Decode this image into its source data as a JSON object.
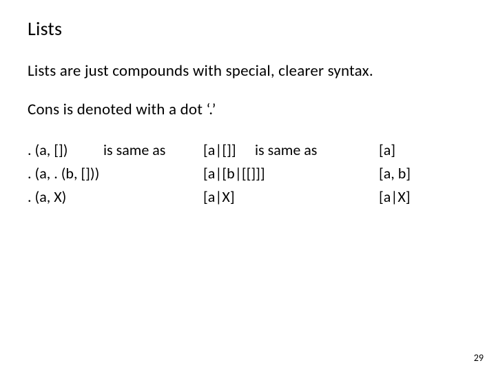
{
  "title": "Lists",
  "para1": "Lists are just compounds with special, clearer syntax.",
  "para2": "Cons is denoted with a dot ‘.’",
  "col1": {
    "r1_left": ". (a, [])",
    "r1_right": "is same as",
    "r2": ". (a, . (b, []))",
    "r3": ". (a, X)"
  },
  "col2": {
    "r1_left": "[a|[]]",
    "r1_right": "is same as",
    "r2": "[a|[b|[[]]]",
    "r3": "[a|X]"
  },
  "col3": {
    "r1": "[a]",
    "r2": "[a, b]",
    "r3": "[a|X]"
  },
  "page_number": "29"
}
